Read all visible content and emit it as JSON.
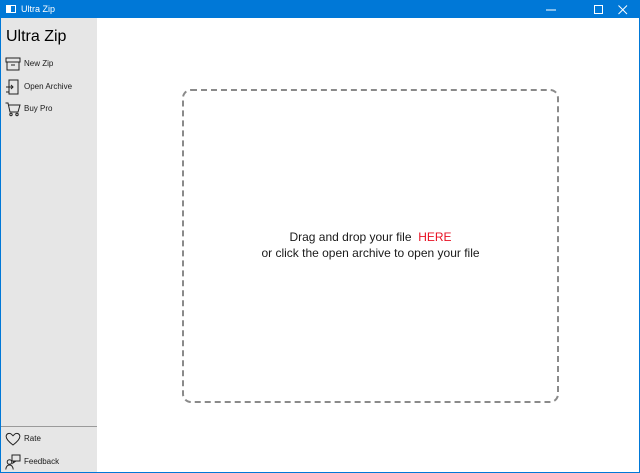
{
  "window": {
    "title": "Ultra Zip",
    "accent_color": "#0078d7",
    "icons": {
      "minimize": "minimize-icon",
      "maximize": "maximize-icon",
      "close": "close-icon"
    }
  },
  "sidebar": {
    "app_name": "Ultra Zip",
    "items": [
      {
        "label": "New Zip",
        "icon": "archive-box-icon"
      },
      {
        "label": "Open Archive",
        "icon": "open-file-icon"
      },
      {
        "label": "Buy Pro",
        "icon": "shopping-cart-icon"
      }
    ],
    "bottom_items": [
      {
        "label": "Rate",
        "icon": "heart-icon"
      },
      {
        "label": "Feedback",
        "icon": "feedback-person-icon"
      }
    ]
  },
  "dropzone": {
    "line1_prefix": "Drag and drop your file",
    "line1_highlight": "HERE",
    "line2": "or click the open archive to open your file",
    "highlight_color": "#e81123"
  }
}
